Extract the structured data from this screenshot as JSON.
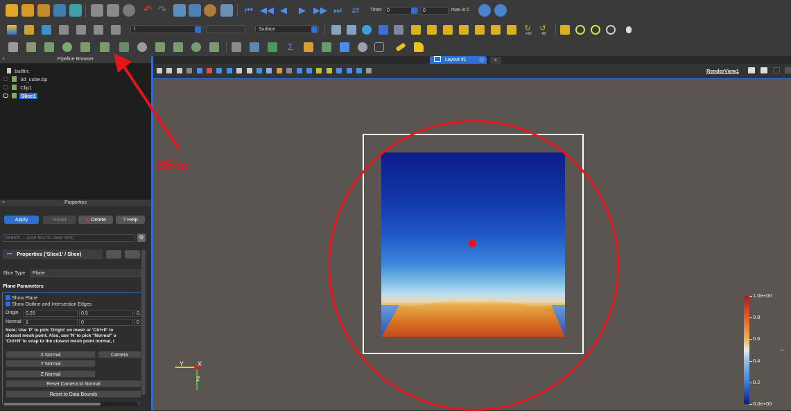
{
  "toolbar_top": {
    "time_label": "Time:",
    "time_value": "0",
    "time_index": "0",
    "max_label": "max is 0"
  },
  "toolbar_second": {
    "color_by_value": "f",
    "component_value": "",
    "representation_value": "Surface",
    "rotate_plus": "+90",
    "rotate_minus": "-90"
  },
  "pipeline_browser": {
    "title": "Pipeline Browser",
    "items": [
      {
        "label": "builtin:"
      },
      {
        "label": "3d_cube.bp"
      },
      {
        "label": "Clip1"
      },
      {
        "label": "Slice1"
      }
    ]
  },
  "annotation": {
    "label": "Slice",
    "color": "#e8141c"
  },
  "properties": {
    "title": "Properties",
    "apply_label": "Apply",
    "reset_label": "Reset",
    "delete_label": "Delete",
    "help_label": "Help",
    "search_placeholder": "Search ... (use Esc to clear text)",
    "section_header": "Properties ('Slice1' / Slice)",
    "slice_type_label": "Slice Type",
    "slice_type_value": "Plane",
    "plane_params_label": "Plane Parameters",
    "show_plane_label": "Show Plane",
    "show_outline_label": "Show Outline and Intersection Edges",
    "origin_label": "Origin",
    "origin_values": [
      "0.25",
      "0.5",
      "0."
    ],
    "normal_label": "Normal",
    "normal_values": [
      "1",
      "0",
      "0"
    ],
    "note_lines": [
      "Note: Use 'P' to pick 'Origin' on mesh or 'Ctrl+P' to",
      "closest mesh point. Also, use 'N' to pick \"Normal\" o",
      "'Ctrl+N' to snap to the closest mesh point normal, i"
    ],
    "x_normal_label": "X Normal",
    "camera_label": "Camera",
    "y_normal_label": "Y Normal",
    "z_normal_label": "Z Normal",
    "reset_camera_label": "Reset Camera to Normal",
    "reset_bounds_label": "Reset to Data Bounds"
  },
  "layout": {
    "tab_label": "Layout #1",
    "add_tab_label": "+",
    "render_view_label": "RenderView1"
  },
  "axes": {
    "y_label": "Y",
    "x_label": "X",
    "z_label": "Z"
  },
  "color_legend": {
    "title": "f",
    "ticks": [
      "1.0e+00",
      "0.8",
      "0.6",
      "0.4",
      "0.2",
      "0.0e+00"
    ]
  },
  "colors": {
    "accent": "#2f6fd1",
    "viewport": "#5a5551",
    "annotation_red": "#e8141c"
  }
}
